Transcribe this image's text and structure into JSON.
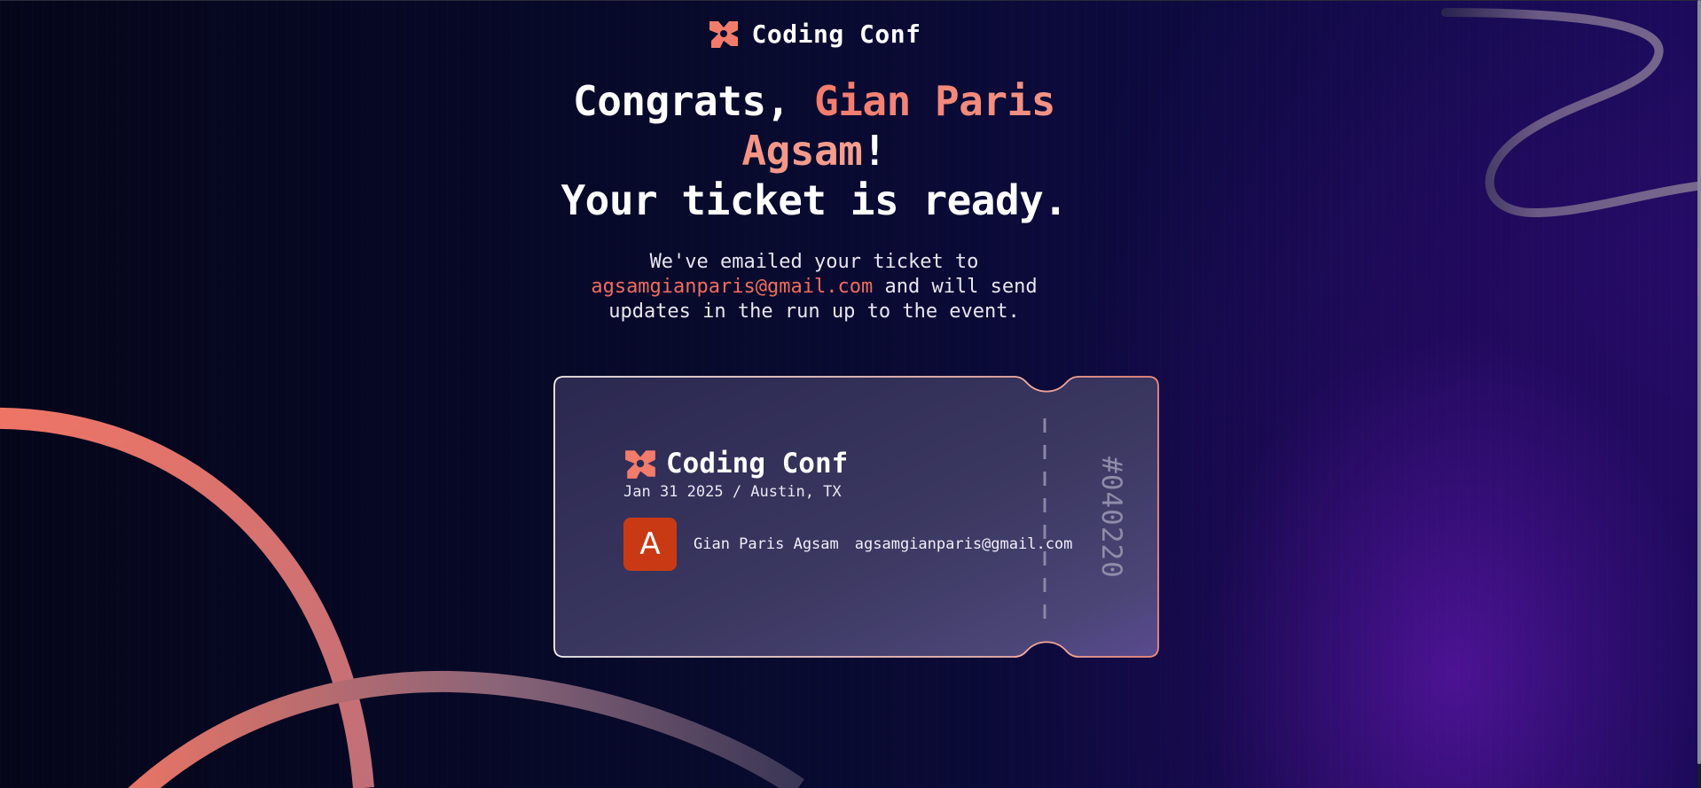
{
  "brand": {
    "name": "Coding Conf",
    "logo_icon": "coding-conf-logo-icon"
  },
  "headline": {
    "congrats": "Congrats, ",
    "name": "Gian Paris Agsam",
    "exclaim": "!",
    "ready": "Your ticket is ready."
  },
  "message": {
    "before_email": "We've emailed your ticket to",
    "email": "agsamgianparis@gmail.com",
    "after_email": " and will send updates in the run up to the event."
  },
  "ticket": {
    "brand_name": "Coding Conf",
    "date_location": "Jan 31 2025 / Austin, TX",
    "avatar_initial": "A",
    "attendee_name": "Gian Paris Agsam",
    "attendee_email": "agsamgianparis@gmail.com",
    "number": "#040220"
  },
  "colors": {
    "accent": "#f37b6c",
    "email": "#f26b5e",
    "avatar_bg": "#c93a14",
    "background": "#080a2e",
    "glow": "#5614a0"
  }
}
